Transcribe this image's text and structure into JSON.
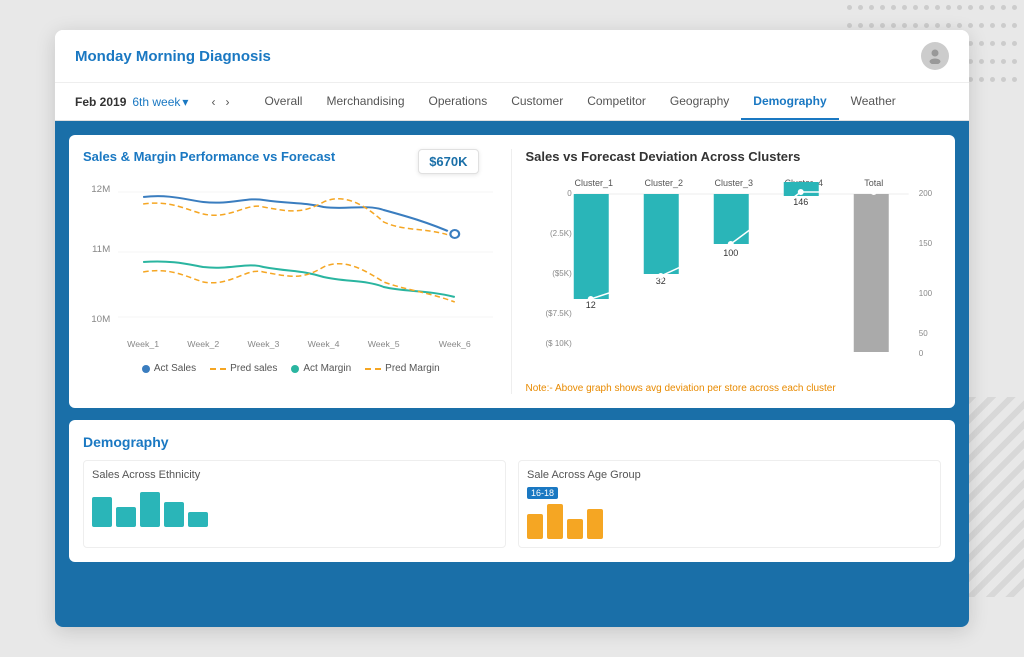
{
  "app": {
    "title": "Monday Morning Diagnosis"
  },
  "header": {
    "date": "Feb 2019",
    "week": "6th week",
    "nav_prev": "‹",
    "nav_next": "›"
  },
  "tabs": [
    {
      "label": "Overall",
      "active": false
    },
    {
      "label": "Merchandising",
      "active": false
    },
    {
      "label": "Operations",
      "active": false
    },
    {
      "label": "Customer",
      "active": false
    },
    {
      "label": "Competitor",
      "active": false
    },
    {
      "label": "Geography",
      "active": false
    },
    {
      "label": "Demography",
      "active": true
    },
    {
      "label": "Weather",
      "active": false
    }
  ],
  "left_chart": {
    "title": "Sales & Margin Performance vs Forecast",
    "price_badge": "$670K",
    "x_labels": [
      "Week_1",
      "Week_2",
      "Week_3",
      "Week_4",
      "Week_5",
      "Week_6"
    ],
    "y_labels": [
      "12M",
      "11M",
      "10M"
    ],
    "legend": [
      {
        "label": "Act Sales",
        "color": "#3a7dbf",
        "type": "dot"
      },
      {
        "label": "Pred sales",
        "color": "#f5a623",
        "type": "dash"
      },
      {
        "label": "Act Margin",
        "color": "#2ab5a0",
        "type": "dot"
      },
      {
        "label": "Pred Margin",
        "color": "#f5a623",
        "type": "dash"
      }
    ]
  },
  "right_chart": {
    "title": "Sales vs Forecast Deviation Across  Clusters",
    "clusters": [
      "Cluster_1",
      "Cluster_2",
      "Cluster_3",
      "Cluster_4",
      "Total"
    ],
    "values": [
      12,
      32,
      100,
      146,
      200
    ],
    "y_labels": [
      "0",
      "(2.5K)",
      "($5K)",
      "($7.5K)",
      "($ 10K)"
    ],
    "y_right_labels": [
      "200",
      "150",
      "100",
      "50",
      "0"
    ],
    "note_prefix": "Note:-",
    "note_text": "Above graph shows avg deviation per store across each cluster"
  },
  "demography_section": {
    "title": "Demography",
    "chart1_title": "Sales Across Ethnicity",
    "chart2_title": "Sale Across Age Group",
    "chart2_badge": "16-18"
  }
}
